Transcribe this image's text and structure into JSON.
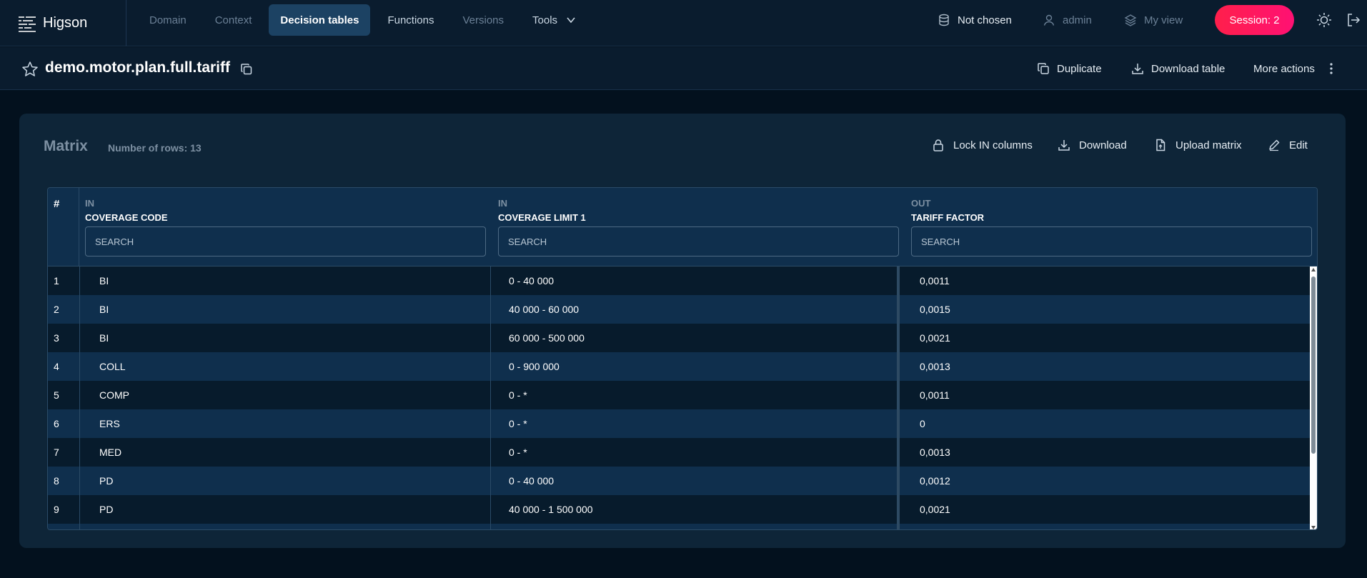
{
  "app": {
    "name": "Higson"
  },
  "nav": {
    "items": [
      {
        "label": "Domain",
        "state": "inactive"
      },
      {
        "label": "Context",
        "state": "inactive"
      },
      {
        "label": "Decision tables",
        "state": "active"
      },
      {
        "label": "Functions",
        "state": "white"
      },
      {
        "label": "Versions",
        "state": "inactive"
      },
      {
        "label": "Tools",
        "state": "white"
      }
    ]
  },
  "header": {
    "database": "Not chosen",
    "user": "admin",
    "view": "My view",
    "session": "Session: 2"
  },
  "page": {
    "title": "demo.motor.plan.full.tariff",
    "actions": {
      "duplicate": "Duplicate",
      "download_table": "Download table",
      "more_actions": "More actions"
    }
  },
  "matrix": {
    "title": "Matrix",
    "row_count": "Number of rows: 13",
    "actions": {
      "lock": "Lock IN columns",
      "download": "Download",
      "upload": "Upload matrix",
      "edit": "Edit"
    },
    "hash_header": "#",
    "columns": [
      {
        "kind": "IN",
        "name": "COVERAGE CODE",
        "placeholder": "SEARCH"
      },
      {
        "kind": "IN",
        "name": "COVERAGE LIMIT 1",
        "placeholder": "SEARCH"
      },
      {
        "kind": "OUT",
        "name": "TARIFF FACTOR",
        "placeholder": "SEARCH"
      }
    ],
    "rows": [
      {
        "n": "1",
        "code": "BI",
        "limit": "0 - 40 000",
        "factor": "0,0011"
      },
      {
        "n": "2",
        "code": "BI",
        "limit": "40 000 - 60 000",
        "factor": "0,0015"
      },
      {
        "n": "3",
        "code": "BI",
        "limit": "60 000 - 500 000",
        "factor": "0,0021"
      },
      {
        "n": "4",
        "code": "COLL",
        "limit": "0 - 900 000",
        "factor": "0,0013"
      },
      {
        "n": "5",
        "code": "COMP",
        "limit": "0 - *",
        "factor": "0,0011"
      },
      {
        "n": "6",
        "code": "ERS",
        "limit": "0 - *",
        "factor": "0"
      },
      {
        "n": "7",
        "code": "MED",
        "limit": "0 - *",
        "factor": "0,0013"
      },
      {
        "n": "8",
        "code": "PD",
        "limit": "0 - 40 000",
        "factor": "0,0012"
      },
      {
        "n": "9",
        "code": "PD",
        "limit": "40 000 - 1 500 000",
        "factor": "0,0021"
      }
    ]
  },
  "colors": {
    "accent": "#ff1f4b",
    "active_tab": "#1c4263",
    "background": "#03111e"
  }
}
